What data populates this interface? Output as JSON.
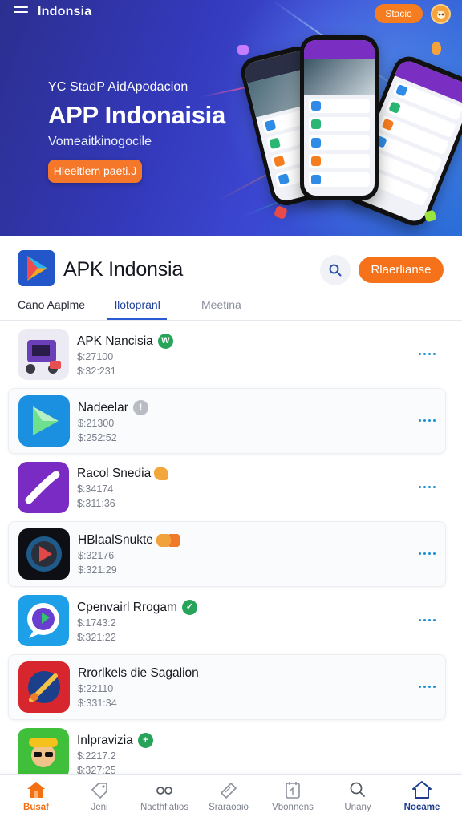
{
  "topbar": {
    "brand": "Indonsia",
    "button": "Stacio"
  },
  "hero": {
    "kicker": "YC StadP AidApodacion",
    "title": "APP Indonaisia",
    "subtitle": "Vomeaitkinogocile",
    "cta": "Hleeitlem paeti.J"
  },
  "header": {
    "app_name": "APK Indonsia",
    "primary_button": "Rlaerlianse"
  },
  "tabs": [
    {
      "label": "Cano Aaplme"
    },
    {
      "label": "llotopranl"
    },
    {
      "label": "Meetina"
    }
  ],
  "apps": [
    {
      "name": "APK Nancisia",
      "badge": "W",
      "badge_color": "#27a35a",
      "line1": "$:27100",
      "line2": "$:32:231"
    },
    {
      "name": "Nadeelar",
      "badge": "!",
      "badge_color": "#b9bcc4",
      "line1": "$:21300",
      "line2": "$:252:52"
    },
    {
      "name": "Racol Snedia",
      "badge": "",
      "badge_color": "",
      "line1": "$:34174",
      "line2": "$:311:36"
    },
    {
      "name": "HBlaalSnukte",
      "badge": "",
      "badge_color": "",
      "line1": "$:32176",
      "line2": "$:321:29"
    },
    {
      "name": "Cpenvairl Rrogam",
      "badge": "✓",
      "badge_color": "#27a35a",
      "line1": "$:1743:2",
      "line2": "$:321:22"
    },
    {
      "name": "Rrorlkels die Sagalion",
      "badge": "",
      "badge_color": "",
      "line1": "$:22110",
      "line2": "$:331:34"
    },
    {
      "name": "Inlpravizia",
      "badge": "+",
      "badge_color": "#27a35a",
      "line1": "$:2217.2",
      "line2": "$:327:25"
    }
  ],
  "bottom_nav": [
    {
      "label": "Busaf",
      "icon": "home-icon"
    },
    {
      "label": "Jeni",
      "icon": "tag-icon"
    },
    {
      "label": "Nacthfiatios",
      "icon": "link-icon"
    },
    {
      "label": "Sraraoaio",
      "icon": "ticket-icon"
    },
    {
      "label": "Vbonnens",
      "icon": "calendar-icon"
    },
    {
      "label": "Unany",
      "icon": "search-icon"
    },
    {
      "label": "Nocame",
      "icon": "house-outline-icon"
    }
  ],
  "colors": {
    "accent": "#f5721b",
    "hero_start": "#2b2f8f",
    "hero_end": "#2a6fd8",
    "link": "#1a8fd0"
  }
}
